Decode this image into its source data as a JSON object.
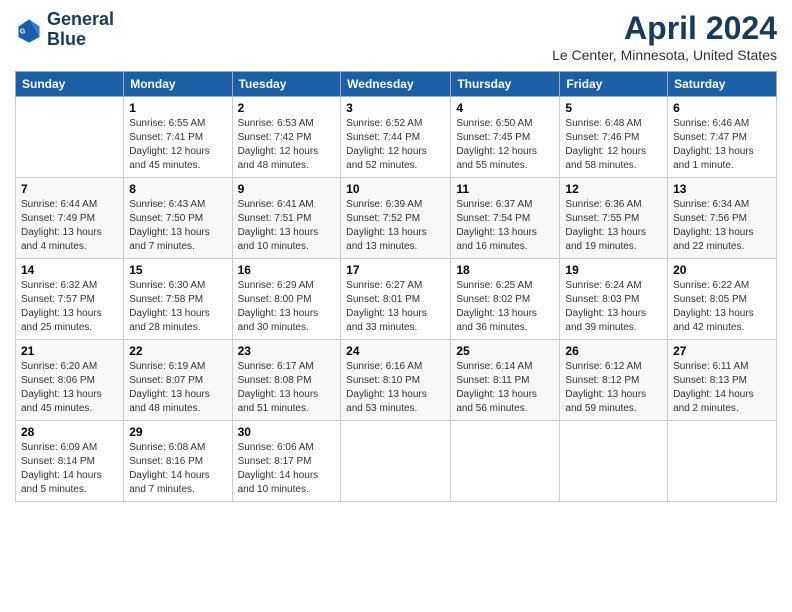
{
  "header": {
    "logo_line1": "General",
    "logo_line2": "Blue",
    "month_title": "April 2024",
    "location": "Le Center, Minnesota, United States"
  },
  "weekdays": [
    "Sunday",
    "Monday",
    "Tuesday",
    "Wednesday",
    "Thursday",
    "Friday",
    "Saturday"
  ],
  "weeks": [
    [
      {
        "day": "",
        "sunrise": "",
        "sunset": "",
        "daylight": ""
      },
      {
        "day": "1",
        "sunrise": "Sunrise: 6:55 AM",
        "sunset": "Sunset: 7:41 PM",
        "daylight": "Daylight: 12 hours and 45 minutes."
      },
      {
        "day": "2",
        "sunrise": "Sunrise: 6:53 AM",
        "sunset": "Sunset: 7:42 PM",
        "daylight": "Daylight: 12 hours and 48 minutes."
      },
      {
        "day": "3",
        "sunrise": "Sunrise: 6:52 AM",
        "sunset": "Sunset: 7:44 PM",
        "daylight": "Daylight: 12 hours and 52 minutes."
      },
      {
        "day": "4",
        "sunrise": "Sunrise: 6:50 AM",
        "sunset": "Sunset: 7:45 PM",
        "daylight": "Daylight: 12 hours and 55 minutes."
      },
      {
        "day": "5",
        "sunrise": "Sunrise: 6:48 AM",
        "sunset": "Sunset: 7:46 PM",
        "daylight": "Daylight: 12 hours and 58 minutes."
      },
      {
        "day": "6",
        "sunrise": "Sunrise: 6:46 AM",
        "sunset": "Sunset: 7:47 PM",
        "daylight": "Daylight: 13 hours and 1 minute."
      }
    ],
    [
      {
        "day": "7",
        "sunrise": "Sunrise: 6:44 AM",
        "sunset": "Sunset: 7:49 PM",
        "daylight": "Daylight: 13 hours and 4 minutes."
      },
      {
        "day": "8",
        "sunrise": "Sunrise: 6:43 AM",
        "sunset": "Sunset: 7:50 PM",
        "daylight": "Daylight: 13 hours and 7 minutes."
      },
      {
        "day": "9",
        "sunrise": "Sunrise: 6:41 AM",
        "sunset": "Sunset: 7:51 PM",
        "daylight": "Daylight: 13 hours and 10 minutes."
      },
      {
        "day": "10",
        "sunrise": "Sunrise: 6:39 AM",
        "sunset": "Sunset: 7:52 PM",
        "daylight": "Daylight: 13 hours and 13 minutes."
      },
      {
        "day": "11",
        "sunrise": "Sunrise: 6:37 AM",
        "sunset": "Sunset: 7:54 PM",
        "daylight": "Daylight: 13 hours and 16 minutes."
      },
      {
        "day": "12",
        "sunrise": "Sunrise: 6:36 AM",
        "sunset": "Sunset: 7:55 PM",
        "daylight": "Daylight: 13 hours and 19 minutes."
      },
      {
        "day": "13",
        "sunrise": "Sunrise: 6:34 AM",
        "sunset": "Sunset: 7:56 PM",
        "daylight": "Daylight: 13 hours and 22 minutes."
      }
    ],
    [
      {
        "day": "14",
        "sunrise": "Sunrise: 6:32 AM",
        "sunset": "Sunset: 7:57 PM",
        "daylight": "Daylight: 13 hours and 25 minutes."
      },
      {
        "day": "15",
        "sunrise": "Sunrise: 6:30 AM",
        "sunset": "Sunset: 7:58 PM",
        "daylight": "Daylight: 13 hours and 28 minutes."
      },
      {
        "day": "16",
        "sunrise": "Sunrise: 6:29 AM",
        "sunset": "Sunset: 8:00 PM",
        "daylight": "Daylight: 13 hours and 30 minutes."
      },
      {
        "day": "17",
        "sunrise": "Sunrise: 6:27 AM",
        "sunset": "Sunset: 8:01 PM",
        "daylight": "Daylight: 13 hours and 33 minutes."
      },
      {
        "day": "18",
        "sunrise": "Sunrise: 6:25 AM",
        "sunset": "Sunset: 8:02 PM",
        "daylight": "Daylight: 13 hours and 36 minutes."
      },
      {
        "day": "19",
        "sunrise": "Sunrise: 6:24 AM",
        "sunset": "Sunset: 8:03 PM",
        "daylight": "Daylight: 13 hours and 39 minutes."
      },
      {
        "day": "20",
        "sunrise": "Sunrise: 6:22 AM",
        "sunset": "Sunset: 8:05 PM",
        "daylight": "Daylight: 13 hours and 42 minutes."
      }
    ],
    [
      {
        "day": "21",
        "sunrise": "Sunrise: 6:20 AM",
        "sunset": "Sunset: 8:06 PM",
        "daylight": "Daylight: 13 hours and 45 minutes."
      },
      {
        "day": "22",
        "sunrise": "Sunrise: 6:19 AM",
        "sunset": "Sunset: 8:07 PM",
        "daylight": "Daylight: 13 hours and 48 minutes."
      },
      {
        "day": "23",
        "sunrise": "Sunrise: 6:17 AM",
        "sunset": "Sunset: 8:08 PM",
        "daylight": "Daylight: 13 hours and 51 minutes."
      },
      {
        "day": "24",
        "sunrise": "Sunrise: 6:16 AM",
        "sunset": "Sunset: 8:10 PM",
        "daylight": "Daylight: 13 hours and 53 minutes."
      },
      {
        "day": "25",
        "sunrise": "Sunrise: 6:14 AM",
        "sunset": "Sunset: 8:11 PM",
        "daylight": "Daylight: 13 hours and 56 minutes."
      },
      {
        "day": "26",
        "sunrise": "Sunrise: 6:12 AM",
        "sunset": "Sunset: 8:12 PM",
        "daylight": "Daylight: 13 hours and 59 minutes."
      },
      {
        "day": "27",
        "sunrise": "Sunrise: 6:11 AM",
        "sunset": "Sunset: 8:13 PM",
        "daylight": "Daylight: 14 hours and 2 minutes."
      }
    ],
    [
      {
        "day": "28",
        "sunrise": "Sunrise: 6:09 AM",
        "sunset": "Sunset: 8:14 PM",
        "daylight": "Daylight: 14 hours and 5 minutes."
      },
      {
        "day": "29",
        "sunrise": "Sunrise: 6:08 AM",
        "sunset": "Sunset: 8:16 PM",
        "daylight": "Daylight: 14 hours and 7 minutes."
      },
      {
        "day": "30",
        "sunrise": "Sunrise: 6:06 AM",
        "sunset": "Sunset: 8:17 PM",
        "daylight": "Daylight: 14 hours and 10 minutes."
      },
      {
        "day": "",
        "sunrise": "",
        "sunset": "",
        "daylight": ""
      },
      {
        "day": "",
        "sunrise": "",
        "sunset": "",
        "daylight": ""
      },
      {
        "day": "",
        "sunrise": "",
        "sunset": "",
        "daylight": ""
      },
      {
        "day": "",
        "sunrise": "",
        "sunset": "",
        "daylight": ""
      }
    ]
  ]
}
